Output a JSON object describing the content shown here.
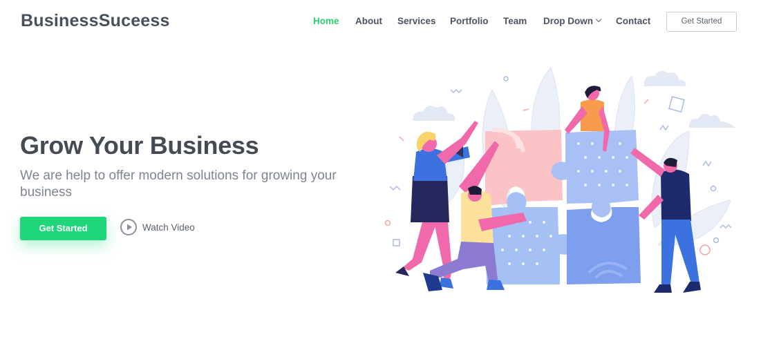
{
  "header": {
    "logo": "BusinessSuceess",
    "nav": [
      {
        "label": "Home",
        "active": true
      },
      {
        "label": "About"
      },
      {
        "label": "Services"
      },
      {
        "label": "Portfolio"
      },
      {
        "label": "Team"
      },
      {
        "label": "Drop Down",
        "icon": "chevron-down-icon"
      },
      {
        "label": "Contact"
      }
    ],
    "cta_label": "Get Started"
  },
  "hero": {
    "title": "Grow Your Business",
    "subtitle": "We are help to offer modern solutions for growing your business",
    "primary_button": "Get Started",
    "video_link": "Watch Video",
    "video_icon": "play-circle-icon"
  },
  "colors": {
    "accent": "#2ecc71",
    "primary_button": "#1fd67a",
    "heading": "#454b53",
    "subtitle": "#7e8590"
  }
}
